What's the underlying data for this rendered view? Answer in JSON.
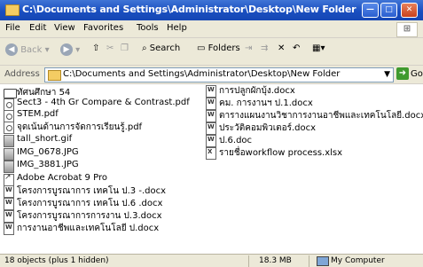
{
  "window": {
    "title": "C:\\Documents and Settings\\Administrator\\Desktop\\New Folder",
    "buttons": {
      "minimize": "—",
      "maximize": "□",
      "close": "✕"
    }
  },
  "menubar": {
    "items": [
      "File",
      "Edit",
      "View",
      "Favorites",
      "Tools",
      "Help"
    ]
  },
  "toolbar": {
    "back": "Back",
    "search": "Search",
    "folders": "Folders"
  },
  "address": {
    "label": "Address",
    "value": "C:\\Documents and Settings\\Administrator\\Desktop\\New Folder",
    "go": "Go"
  },
  "files_left": [
    {
      "name": "ทัศนศึกษา 54",
      "type": "folder-icon"
    },
    {
      "name": "Sect3 - 4th Gr Compare & Contrast.pdf",
      "type": "pdf-icon"
    },
    {
      "name": "STEM.pdf",
      "type": "pdf-icon"
    },
    {
      "name": "จุดเน้นด้านการจัดการเรียนรู้.pdf",
      "type": "pdf-icon"
    },
    {
      "name": "tall_short.gif",
      "type": "image-icon"
    },
    {
      "name": "IMG_0678.JPG",
      "type": "image-icon"
    },
    {
      "name": "IMG_3881.JPG",
      "type": "image-icon"
    },
    {
      "name": "Adobe Acrobat 9 Pro",
      "type": "shortcut-icon"
    },
    {
      "name": "โครงการบูรณาการ เทคโน ป.3 -.docx",
      "type": "word-doc-icon"
    },
    {
      "name": "โครงการบูรณาการ เทคโน ป.6 .docx",
      "type": "word-doc-icon"
    },
    {
      "name": "โครงการบูรณาการการงาน ป.3.docx",
      "type": "word-doc-icon"
    },
    {
      "name": "การงานอาชีพและเทคโนโลยี ป.docx",
      "type": "word-doc-icon"
    }
  ],
  "files_right": [
    {
      "name": "การปลูกผักบุ้ง.docx",
      "type": "word-doc-icon"
    },
    {
      "name": "คม. การงานฯ ป.1.docx",
      "type": "word-doc-icon"
    },
    {
      "name": "ตารางแผนงานวิชาการงานอาชีพและเทคโนโลยี.docx",
      "type": "word-doc-icon"
    },
    {
      "name": "ประวัติคอมพิวเตอร์.docx",
      "type": "word-doc-icon"
    },
    {
      "name": "ป.6.doc",
      "type": "word-doc-icon"
    },
    {
      "name": "รายชื่อworkflow process.xlsx",
      "type": "excel-icon"
    }
  ],
  "status": {
    "objects": "18 objects (plus 1 hidden)",
    "size": "18.3 MB",
    "location": "My Computer"
  }
}
